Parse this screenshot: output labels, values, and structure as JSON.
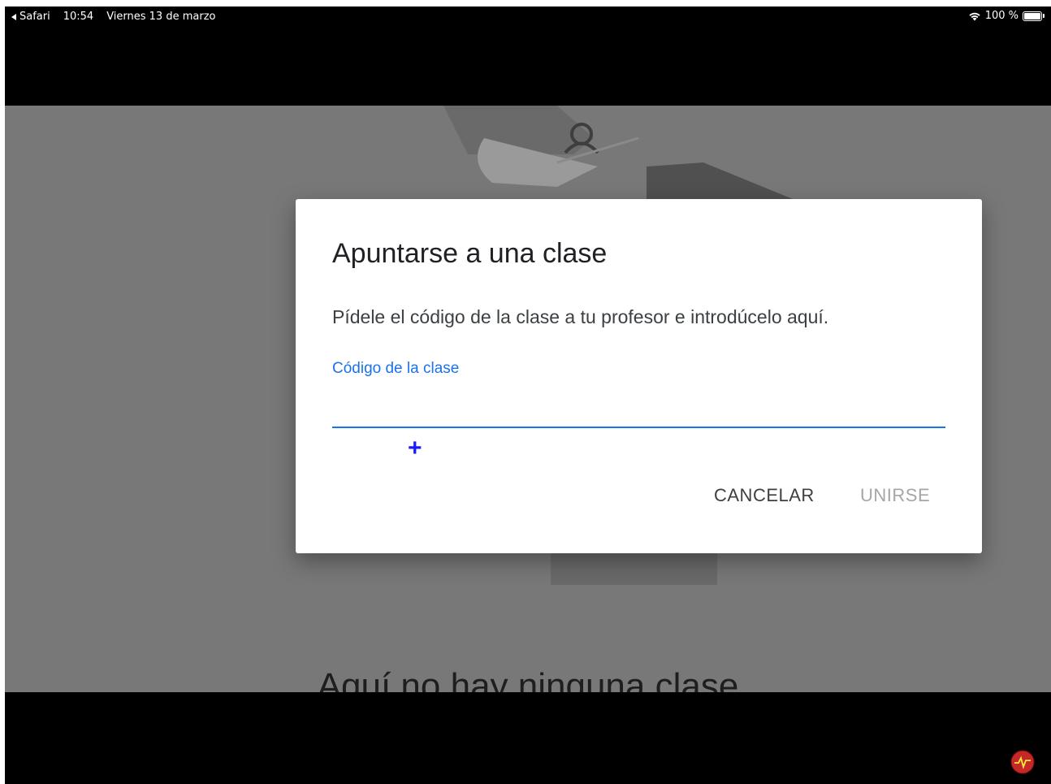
{
  "status_bar": {
    "back_app": "Safari",
    "time": "10:54",
    "date": "Viernes 13 de marzo",
    "battery": "100 %"
  },
  "background_page": {
    "empty_message": "Aquí no hay ninguna clase"
  },
  "dialog": {
    "title": "Apuntarse a una clase",
    "description": "Pídele el código de la clase a tu profesor e introdúcelo aquí.",
    "field_label": "Código de la clase",
    "field_value": "",
    "cancel_label": "CANCELAR",
    "join_label": "UNIRSE"
  },
  "colors": {
    "accent": "#1a73e8",
    "disabled_text": "#a6a6a6",
    "scrim": "#787878"
  },
  "icons": {
    "wifi": "wifi-icon",
    "battery": "battery-icon",
    "cursor": "crosshair-plus-icon",
    "logo": "channel-logo-icon"
  }
}
